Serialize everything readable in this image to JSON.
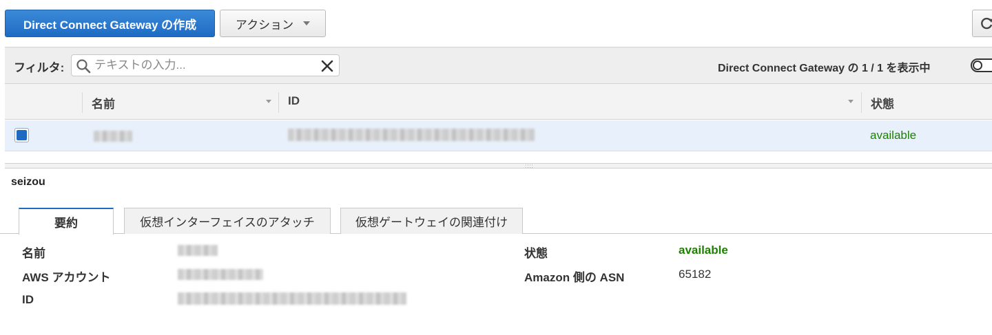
{
  "toolbar": {
    "create_label": "Direct Connect Gateway の作成",
    "actions_label": "アクション",
    "refresh_icon": "refresh-icon"
  },
  "filter": {
    "label": "フィルタ:",
    "placeholder": "テキストの入力...",
    "value": "",
    "count_text": "Direct Connect Gateway の 1 / 1 を表示中"
  },
  "table": {
    "columns": [
      "名前",
      "ID",
      "状態"
    ],
    "rows": [
      {
        "selected": true,
        "name": "",
        "id": "",
        "status": "available"
      }
    ]
  },
  "details": {
    "title": "seizou",
    "tabs": [
      "要約",
      "仮想インターフェイスのアタッチ",
      "仮想ゲートウェイの関連付け"
    ],
    "active_tab": 0,
    "fields_left": [
      {
        "label": "名前",
        "value": ""
      },
      {
        "label": "AWS アカウント",
        "value": ""
      },
      {
        "label": "ID",
        "value": ""
      }
    ],
    "fields_right": [
      {
        "label": "状態",
        "value": "available"
      },
      {
        "label": "Amazon 側の ASN",
        "value": "65182"
      }
    ]
  },
  "colors": {
    "primary": "#1f6bc4",
    "status_ok": "#1d8102",
    "selected_row": "#e8f0fb"
  }
}
